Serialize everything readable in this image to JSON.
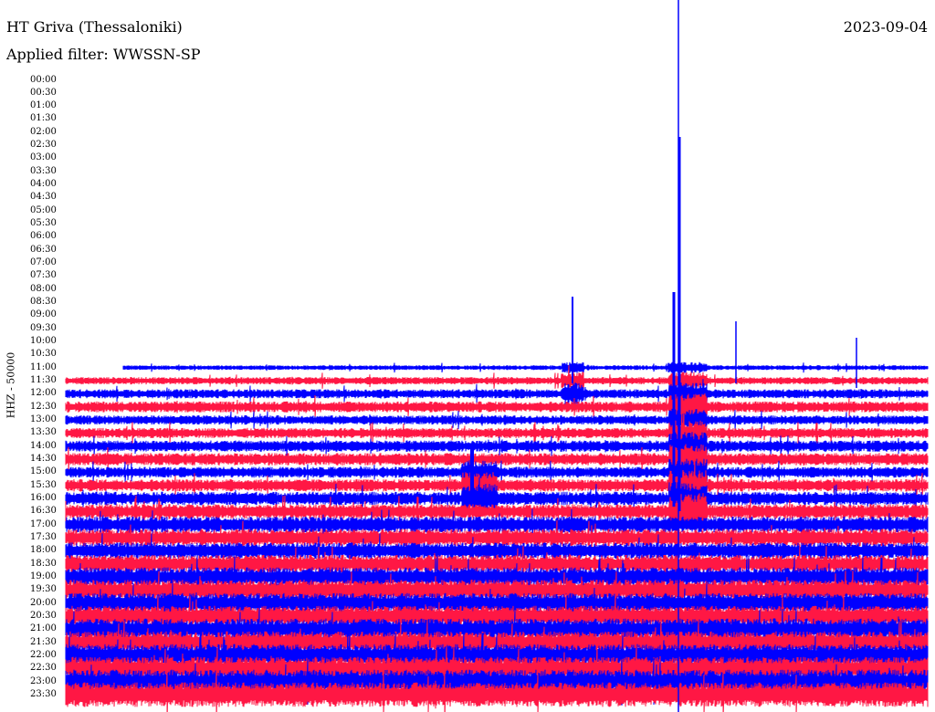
{
  "header": {
    "station": "HT Griva (Thessaloniki)",
    "filter": "Applied filter: WWSSN-SP",
    "date": "2023-09-04"
  },
  "channel": "HHZ - 50000",
  "hours": [
    "00:00",
    "00:30",
    "01:00",
    "01:30",
    "02:00",
    "02:30",
    "03:00",
    "03:30",
    "04:00",
    "04:30",
    "05:00",
    "05:30",
    "06:00",
    "06:30",
    "07:00",
    "07:30",
    "08:00",
    "08:30",
    "09:00",
    "09:30",
    "10:00",
    "10:30",
    "11:00",
    "11:30",
    "12:00",
    "12:30",
    "13:00",
    "13:30",
    "14:00",
    "14:30",
    "15:00",
    "15:30",
    "16:00",
    "16:30",
    "17:00",
    "17:30",
    "18:00",
    "18:30",
    "19:00",
    "19:30",
    "20:00",
    "20:30",
    "21:00",
    "21:30",
    "22:00",
    "22:30",
    "23:00",
    "23:30"
  ],
  "colors": {
    "trace_a": "#0000ff",
    "trace_b": "#ff1744",
    "text": "#000000",
    "background": "#ffffff"
  }
}
